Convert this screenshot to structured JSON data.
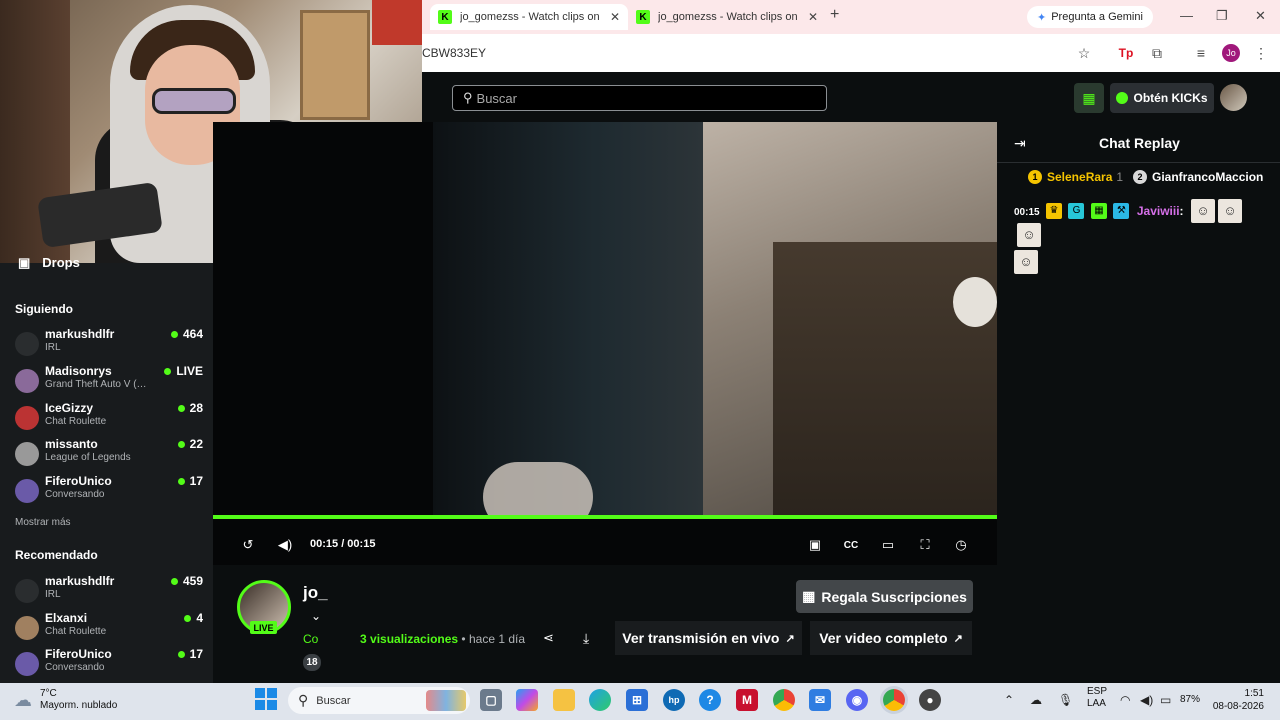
{
  "browser": {
    "tabs": [
      {
        "favicon": "K",
        "title": "jo_gomezss - Watch clips on Kick",
        "active": true
      },
      {
        "favicon": "K",
        "title": "jo_gomezss - Watch clips on Kick",
        "active": false
      }
    ],
    "new_tab": "+",
    "gemini_label": "Pregunta a Gemini",
    "url": "CBW833EY",
    "profile_initials": "Jo",
    "window_controls": [
      "—",
      "❐",
      "✕"
    ]
  },
  "header": {
    "search_placeholder": "Buscar",
    "kicks_label": "Obtén KICKs"
  },
  "sidebar": {
    "drops_label": "Drops",
    "following_title": "Siguiendo",
    "following": [
      {
        "name": "markushdlfr",
        "category": "IRL",
        "viewers": "464"
      },
      {
        "name": "Madisonrys",
        "category": "Grand Theft Auto V (…",
        "viewers": "LIVE"
      },
      {
        "name": "IceGizzy",
        "category": "Chat Roulette",
        "viewers": "28"
      },
      {
        "name": "missanto",
        "category": "League of Legends",
        "viewers": "22"
      },
      {
        "name": "FiferoUnico",
        "category": "Conversando",
        "viewers": "17"
      }
    ],
    "show_more": "Mostrar más",
    "recommended_title": "Recomendado",
    "recommended": [
      {
        "name": "markushdlfr",
        "category": "IRL",
        "viewers": "459"
      },
      {
        "name": "Elxanxi",
        "category": "Chat Roulette",
        "viewers": "4"
      },
      {
        "name": "FiferoUnico",
        "category": "Conversando",
        "viewers": "17"
      }
    ]
  },
  "player": {
    "time": "00:15 / 00:15",
    "progress": 1.0
  },
  "chat": {
    "title": "Chat Replay",
    "gifters": [
      {
        "rank": "1",
        "name": "SeleneRara",
        "count": "1",
        "color": "#f5c400"
      },
      {
        "rank": "2",
        "name": "GianfrancoMaccion",
        "count": "",
        "color": "#d9d9d9"
      }
    ],
    "message": {
      "time": "00:15",
      "user": "Javiwiii",
      "colon": ":"
    }
  },
  "video_info": {
    "channel": "jo_",
    "live_badge": "LIVE",
    "category": "Co",
    "tag_count": "18",
    "views_count": "3",
    "views_label": "visualizaciones",
    "separator": "•",
    "ago": "hace 1 día",
    "live_button": "Ver transmisión en vivo",
    "full_video_button": "Ver video completo",
    "subs_button": "Regala Suscripciones"
  },
  "taskbar": {
    "temperature": "7°C",
    "weather": "Mayorm. nublado",
    "search_placeholder": "Buscar",
    "language": "ESP",
    "region": "LAA",
    "battery": "87%",
    "time": "1:51",
    "date": "08-08-2026"
  },
  "colors": {
    "kick_green": "#53fc18",
    "background": "#0b0e0f"
  }
}
